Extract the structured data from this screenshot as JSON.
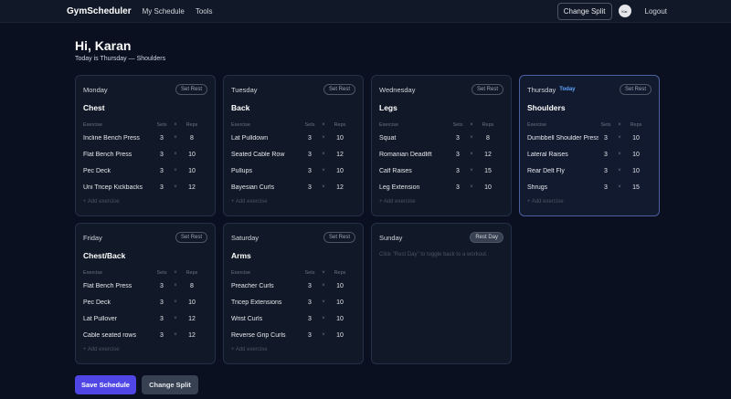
{
  "nav": {
    "brand": "GymScheduler",
    "links": [
      "My Schedule",
      "Tools"
    ],
    "change_split": "Change Split",
    "avatar_text": "Kar",
    "logout": "Logout"
  },
  "header": {
    "greeting": "Hi, Karan",
    "subtitle": "Today is Thursday — Shoulders"
  },
  "table_headers": {
    "exercise": "Exercise",
    "sets": "Sets",
    "x": "×",
    "reps": "Reps"
  },
  "labels": {
    "set_rest": "Set Rest",
    "rest_day": "Rest Day",
    "add_exercise": "+ Add exercise",
    "today": "Today",
    "rest_hint": "Click \"Rest Day\" to toggle back to a workout."
  },
  "days": [
    {
      "day": "Monday",
      "split": "Chest",
      "exercises": [
        {
          "name": "Incline Bench Press",
          "sets": "3",
          "reps": "8"
        },
        {
          "name": "Flat Bench Press",
          "sets": "3",
          "reps": "10"
        },
        {
          "name": "Pec Deck",
          "sets": "3",
          "reps": "10"
        },
        {
          "name": "Uni Tricep Kickbacks",
          "sets": "3",
          "reps": "12"
        }
      ]
    },
    {
      "day": "Tuesday",
      "split": "Back",
      "exercises": [
        {
          "name": "Lat Pulldown",
          "sets": "3",
          "reps": "10"
        },
        {
          "name": "Seated Cable Row",
          "sets": "3",
          "reps": "12"
        },
        {
          "name": "Pullups",
          "sets": "3",
          "reps": "10"
        },
        {
          "name": "Bayesian Curls",
          "sets": "3",
          "reps": "12"
        }
      ]
    },
    {
      "day": "Wednesday",
      "split": "Legs",
      "exercises": [
        {
          "name": "Squat",
          "sets": "3",
          "reps": "8"
        },
        {
          "name": "Romanian Deadlift",
          "sets": "3",
          "reps": "12"
        },
        {
          "name": "Calf Raises",
          "sets": "3",
          "reps": "15"
        },
        {
          "name": "Leg Extension",
          "sets": "3",
          "reps": "10"
        }
      ]
    },
    {
      "day": "Thursday",
      "split": "Shoulders",
      "exercises": [
        {
          "name": "Dumbbell Shoulder Press",
          "sets": "3",
          "reps": "10"
        },
        {
          "name": "Lateral Raises",
          "sets": "3",
          "reps": "10"
        },
        {
          "name": "Rear Delt Fly",
          "sets": "3",
          "reps": "10"
        },
        {
          "name": "Shrugs",
          "sets": "3",
          "reps": "15"
        }
      ]
    },
    {
      "day": "Friday",
      "split": "Chest/Back",
      "exercises": [
        {
          "name": "Flat Bench Press",
          "sets": "3",
          "reps": "8"
        },
        {
          "name": "Pec Deck",
          "sets": "3",
          "reps": "10"
        },
        {
          "name": "Lat Pullover",
          "sets": "3",
          "reps": "12"
        },
        {
          "name": "Cable seated rows",
          "sets": "3",
          "reps": "12"
        }
      ]
    },
    {
      "day": "Saturday",
      "split": "Arms",
      "exercises": [
        {
          "name": "Preacher Curls",
          "sets": "3",
          "reps": "10"
        },
        {
          "name": "Tricep Extensions",
          "sets": "3",
          "reps": "10"
        },
        {
          "name": "Wrist Curls",
          "sets": "3",
          "reps": "10"
        },
        {
          "name": "Reverse Grip Curls",
          "sets": "3",
          "reps": "10"
        }
      ]
    },
    {
      "day": "Sunday"
    }
  ],
  "actions": {
    "save": "Save Schedule",
    "change_split": "Change Split"
  }
}
